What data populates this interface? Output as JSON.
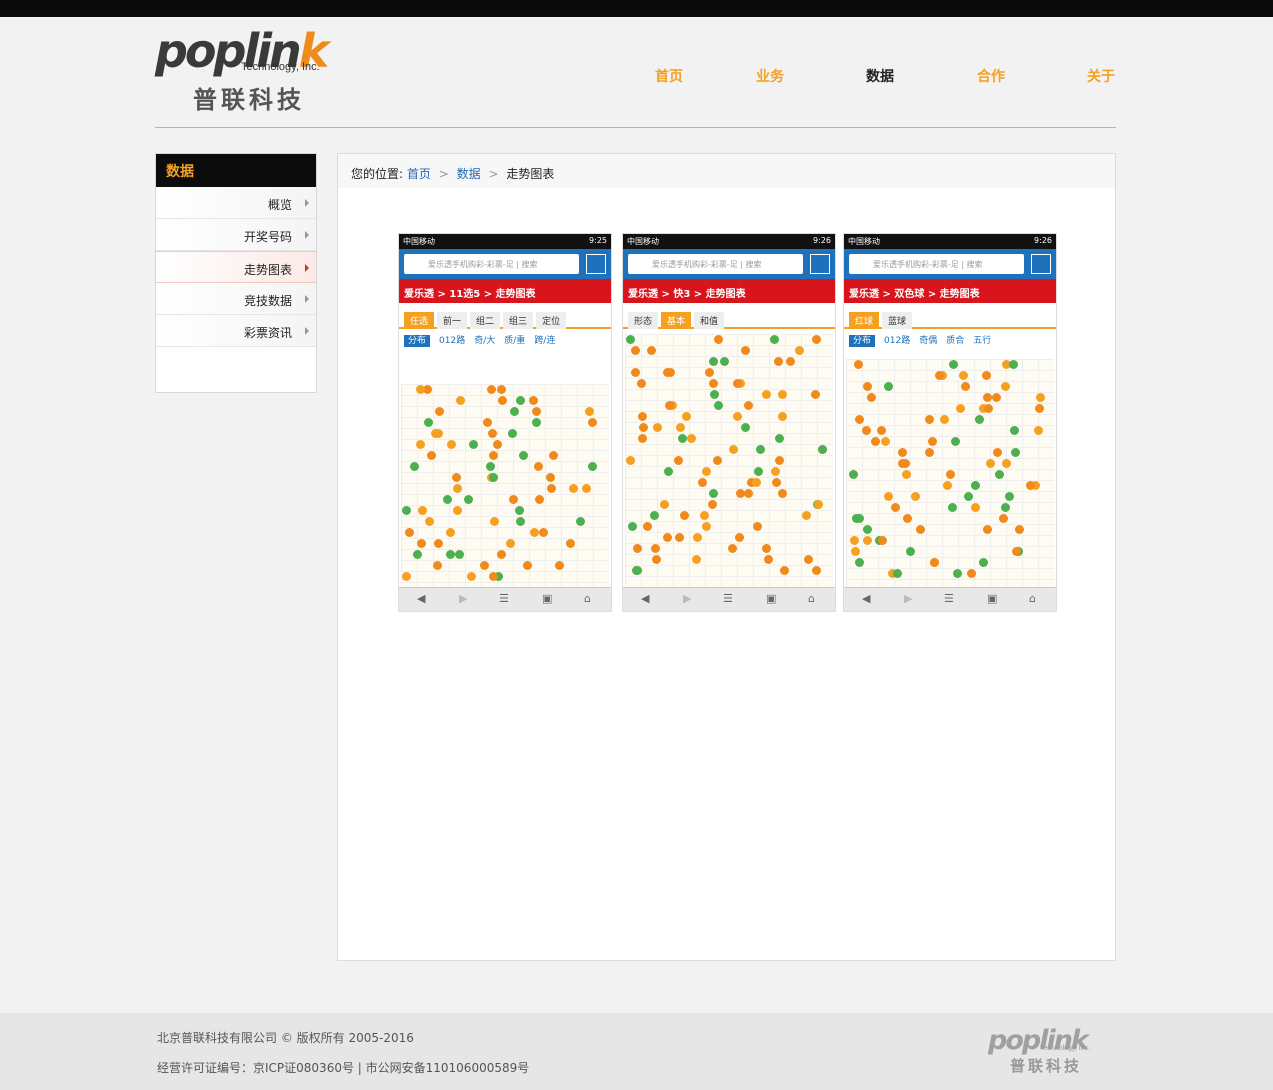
{
  "logo": {
    "brand": "poplink",
    "tagline": "Technology, Inc.",
    "cn": "普联科技"
  },
  "nav": [
    {
      "label": "首页",
      "active": false
    },
    {
      "label": "业务",
      "active": false
    },
    {
      "label": "数据",
      "active": true
    },
    {
      "label": "合作",
      "active": false
    },
    {
      "label": "关于",
      "active": false
    }
  ],
  "sidebar": {
    "title": "数据",
    "items": [
      {
        "label": "概览",
        "active": false
      },
      {
        "label": "开奖号码",
        "active": false
      },
      {
        "label": "走势图表",
        "active": true
      },
      {
        "label": "竞技数据",
        "active": false
      },
      {
        "label": "彩票资讯",
        "active": false
      }
    ]
  },
  "breadcrumb": {
    "prefix": "您的位置:",
    "home": "首页",
    "section": "数据",
    "current": "走势图表",
    "sep": ">"
  },
  "phones": [
    {
      "carrier": "中国移动",
      "time": "9:25",
      "search_placeholder": "爱乐透手机购彩-彩票-足  |  搜索",
      "title": "爱乐透 > 11选5 > 走势图表",
      "tabs": [
        "任选",
        "前一",
        "组二",
        "组三",
        "定位"
      ],
      "active_tab": 0,
      "subtabs": [
        "分布",
        "012路",
        "奇/大",
        "质/重",
        "跨/连"
      ]
    },
    {
      "carrier": "中国移动",
      "time": "9:26",
      "search_placeholder": "爱乐透手机购彩-彩票-足  |  搜索",
      "title": "爱乐透 > 快3 > 走势图表",
      "tabs": [
        "形态",
        "基本",
        "和值"
      ],
      "active_tab": 1,
      "subtabs": []
    },
    {
      "carrier": "中国移动",
      "time": "9:26",
      "search_placeholder": "爱乐透手机购彩-彩票-足  |  搜索",
      "title": "爱乐透 > 双色球 > 走势图表",
      "tabs": [
        "红球",
        "蓝球"
      ],
      "active_tab": 0,
      "subtabs": [
        "分布",
        "012路",
        "奇偶",
        "质合",
        "五行"
      ]
    }
  ],
  "footer": {
    "copyright": "北京普联科技有限公司 © 版权所有 2005-2016",
    "license": "经营许可证编号：京ICP证080360号 | 市公网安备110106000589号"
  },
  "colors": {
    "accent": "#f5a021",
    "dark": "#0c0c0c",
    "link": "#2167b8",
    "phone_red": "#d8141c",
    "phone_blue": "#1e72bc"
  }
}
